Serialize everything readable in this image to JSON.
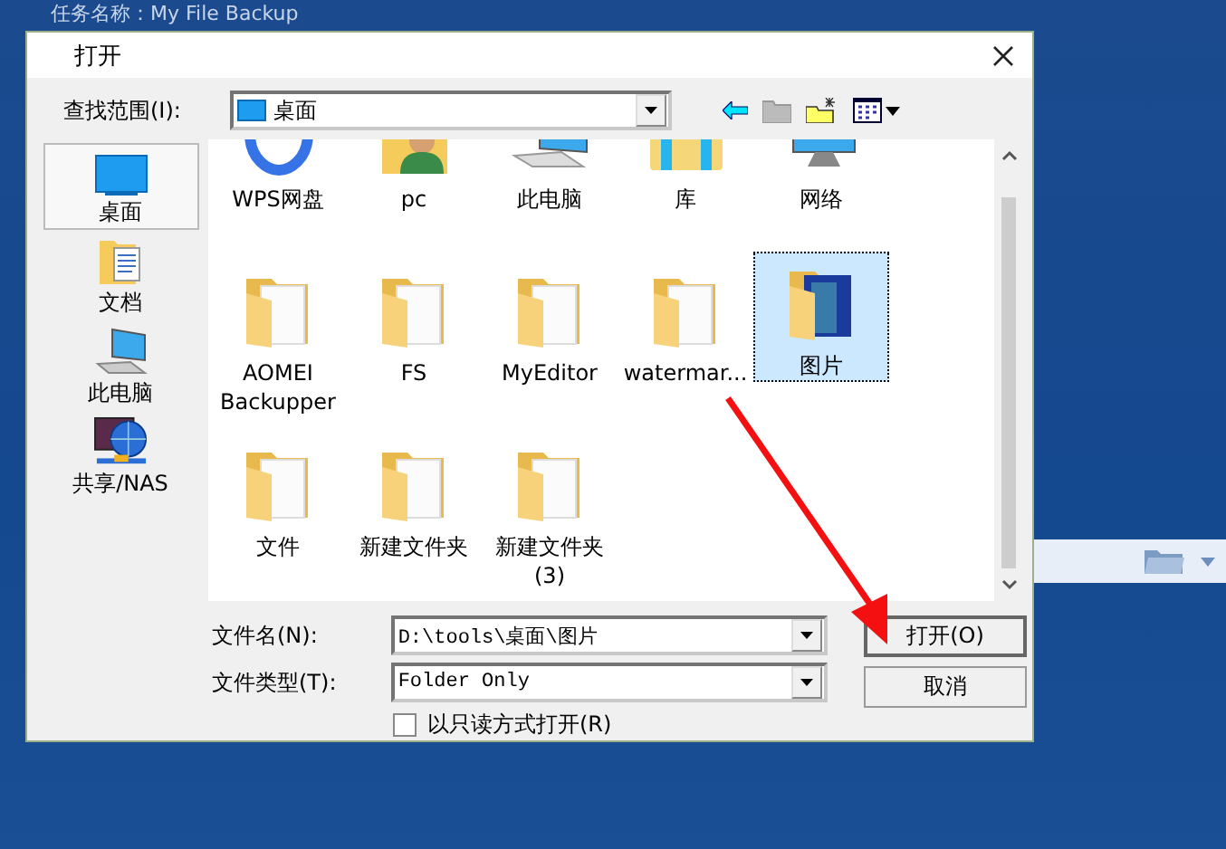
{
  "background": {
    "task_name": "任务名称：My File Backup"
  },
  "dialog": {
    "title": "打开",
    "look_in": {
      "label": "查找范围(I):",
      "value": "桌面"
    },
    "sidebar": [
      {
        "label": "桌面",
        "kind": "desktop",
        "selected": true
      },
      {
        "label": "文档",
        "kind": "documents",
        "selected": false
      },
      {
        "label": "此电脑",
        "kind": "computer",
        "selected": false
      },
      {
        "label": "共享/NAS",
        "kind": "network",
        "selected": false
      }
    ],
    "files": [
      {
        "label": "WPS网盘",
        "kind": "cloud",
        "selected": false
      },
      {
        "label": "pc",
        "kind": "user",
        "selected": false
      },
      {
        "label": "此电脑",
        "kind": "computer",
        "selected": false
      },
      {
        "label": "库",
        "kind": "library",
        "selected": false
      },
      {
        "label": "网络",
        "kind": "network",
        "selected": false
      },
      {
        "label": "AOMEI Backupper",
        "kind": "folder",
        "selected": false
      },
      {
        "label": "FS",
        "kind": "folder",
        "selected": false
      },
      {
        "label": "MyEditor",
        "kind": "folder",
        "selected": false
      },
      {
        "label": "watermar...",
        "kind": "folder",
        "selected": false
      },
      {
        "label": "图片",
        "kind": "pictures",
        "selected": true
      },
      {
        "label": "文件",
        "kind": "folder",
        "selected": false
      },
      {
        "label": "新建文件夹",
        "kind": "folder",
        "selected": false
      },
      {
        "label": "新建文件夹 (3)",
        "kind": "folder",
        "selected": false
      }
    ],
    "file_name": {
      "label": "文件名(N):",
      "value": "D:\\tools\\桌面\\图片"
    },
    "file_type": {
      "label": "文件类型(T):",
      "value": "Folder Only"
    },
    "readonly": {
      "label": "以只读方式打开(R)",
      "checked": false
    },
    "buttons": [
      {
        "label": "打开(O)",
        "default": true
      },
      {
        "label": "取消",
        "default": false
      }
    ]
  }
}
